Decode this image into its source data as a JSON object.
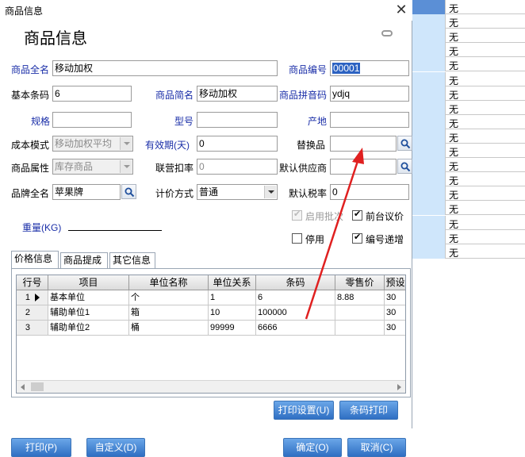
{
  "window": {
    "title": "商品信息",
    "heading": "商品信息",
    "close": "✕"
  },
  "form": {
    "full_name": {
      "label": "商品全名",
      "value": "移动加权"
    },
    "code": {
      "label": "商品编号",
      "value": "00001"
    },
    "barcode": {
      "label": "基本条码",
      "value": "6"
    },
    "short_name": {
      "label": "商品简名",
      "value": "移动加权"
    },
    "pinyin": {
      "label": "商品拼音码",
      "value": "ydjq"
    },
    "spec": {
      "label": "规格",
      "value": ""
    },
    "model": {
      "label": "型号",
      "value": ""
    },
    "origin": {
      "label": "产地",
      "value": ""
    },
    "cost_mode": {
      "label": "成本模式",
      "value": "移动加权平均"
    },
    "shelf_life": {
      "label": "有效期(天)",
      "value": "0"
    },
    "substitute": {
      "label": "替换品",
      "value": ""
    },
    "attribute": {
      "label": "商品属性",
      "value": "库存商品"
    },
    "joint_rate": {
      "label": "联营扣率",
      "value": "0"
    },
    "default_supplier": {
      "label": "默认供应商",
      "value": ""
    },
    "brand": {
      "label": "品牌全名",
      "value": "苹果牌"
    },
    "pricing": {
      "label": "计价方式",
      "value": "普通"
    },
    "tax_rate": {
      "label": "默认税率",
      "value": "0"
    },
    "weight": {
      "label": "重量(KG)"
    },
    "batch": {
      "label": "启用批次",
      "checked": true
    },
    "negotiate": {
      "label": "前台议价",
      "checked": true
    },
    "disabled": {
      "label": "停用",
      "checked": false
    },
    "auto_number": {
      "label": "编号递增",
      "checked": true
    }
  },
  "tabs": [
    "价格信息",
    "商品提成",
    "其它信息"
  ],
  "grid": {
    "headers": [
      "行号",
      "项目",
      "单位名称",
      "单位关系",
      "条码",
      "零售价",
      "预设"
    ],
    "rows": [
      [
        "1",
        "基本单位",
        "个",
        "1",
        "6",
        "8.88",
        "30"
      ],
      [
        "2",
        "辅助单位1",
        "箱",
        "10",
        "100000",
        "",
        "30"
      ],
      [
        "3",
        "辅助单位2",
        "桶",
        "99999",
        "6666",
        "",
        "30"
      ]
    ]
  },
  "buttons": {
    "print_settings": "打印设置(U)",
    "barcode_print": "条码打印",
    "print": "打印(P)",
    "customize": "自定义(D)",
    "ok": "确定(O)",
    "cancel": "取消(C)"
  },
  "background_column": [
    "无",
    "无",
    "无",
    "无",
    "无",
    "无",
    "无",
    "无",
    "无",
    "无",
    "无",
    "无",
    "无",
    "无",
    "无",
    "无",
    "无",
    "无"
  ],
  "colors": {
    "accent": "#2f6fc3",
    "label_blue": "#1a2ea8",
    "arrow": "#e02020",
    "selection": "#2c62c2"
  }
}
